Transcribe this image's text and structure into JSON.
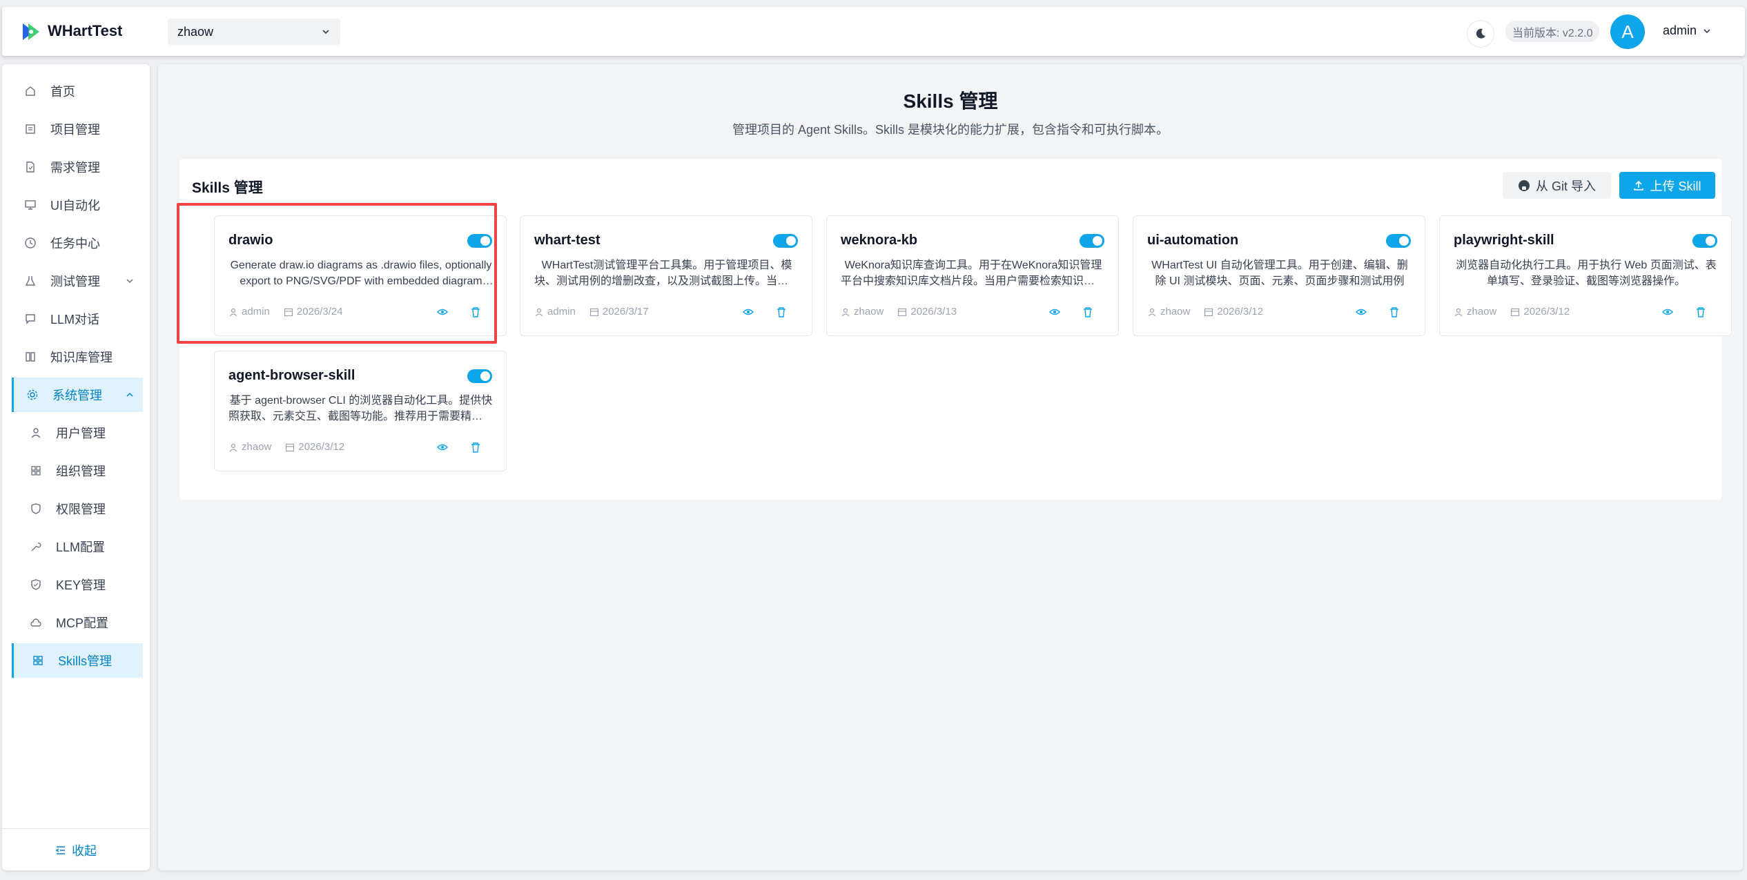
{
  "header": {
    "app_title": "WHartTest",
    "project": "zhaow",
    "version_label": "当前版本: v2.2.0",
    "avatar_letter": "A",
    "user": "admin"
  },
  "sidebar": {
    "items": [
      {
        "label": "首页",
        "icon": "home-icon"
      },
      {
        "label": "项目管理",
        "icon": "list-icon"
      },
      {
        "label": "需求管理",
        "icon": "doc-icon"
      },
      {
        "label": "UI自动化",
        "icon": "monitor-icon"
      },
      {
        "label": "任务中心",
        "icon": "clock-icon"
      },
      {
        "label": "测试管理",
        "icon": "flask-icon"
      },
      {
        "label": "LLM对话",
        "icon": "chat-icon"
      },
      {
        "label": "知识库管理",
        "icon": "book-icon"
      },
      {
        "label": "系统管理",
        "icon": "gear-icon"
      },
      {
        "label": "用户管理",
        "icon": "user-icon"
      },
      {
        "label": "组织管理",
        "icon": "grid-icon"
      },
      {
        "label": "权限管理",
        "icon": "shield-icon"
      },
      {
        "label": "LLM配置",
        "icon": "tool-icon"
      },
      {
        "label": "KEY管理",
        "icon": "shield-icon"
      },
      {
        "label": "MCP配置",
        "icon": "cloud-icon"
      },
      {
        "label": "Skills管理",
        "icon": "grid-icon"
      }
    ],
    "collapse_label": "收起"
  },
  "main": {
    "title": "Skills 管理",
    "subtitle": "管理项目的 Agent Skills。Skills 是模块化的能力扩展，包含指令和可执行脚本。",
    "panel_title": "Skills 管理",
    "git_import_label": "从 Git 导入",
    "upload_label": "上传 Skill",
    "cards": [
      {
        "name": "drawio",
        "desc": "Generate draw.io diagrams as .drawio files, optionally export to PNG/SVG/PDF with embedded diagram XML",
        "author": "admin",
        "date": "2026/3/24"
      },
      {
        "name": "whart-test",
        "desc": "WHartTest测试管理平台工具集。用于管理项目、模块、测试用例的增删改查，以及测试截图上传。当需要操作测试数据时使用",
        "author": "admin",
        "date": "2026/3/17"
      },
      {
        "name": "weknora-kb",
        "desc": "WeKnora知识库查询工具。用于在WeKnora知识管理平台中搜索知识库文档片段。当用户需要检索知识库内容时使用",
        "author": "zhaow",
        "date": "2026/3/13"
      },
      {
        "name": "ui-automation",
        "desc": "WHartTest UI 自动化管理工具。用于创建、编辑、删除 UI 测试模块、页面、元素、页面步骤和测试用例",
        "author": "zhaow",
        "date": "2026/3/12"
      },
      {
        "name": "playwright-skill",
        "desc": "浏览器自动化执行工具。用于执行 Web 页面测试、表单填写、登录验证、截图等浏览器操作。",
        "author": "zhaow",
        "date": "2026/3/12"
      },
      {
        "name": "agent-browser-skill",
        "desc": "基于 agent-browser CLI 的浏览器自动化工具。提供快照获取、元素交互、截图等功能。推荐用于需要精确控制的场景",
        "author": "zhaow",
        "date": "2026/3/12"
      }
    ]
  },
  "colors": {
    "accent": "#0ea5e9",
    "highlight": "#ef4444"
  }
}
